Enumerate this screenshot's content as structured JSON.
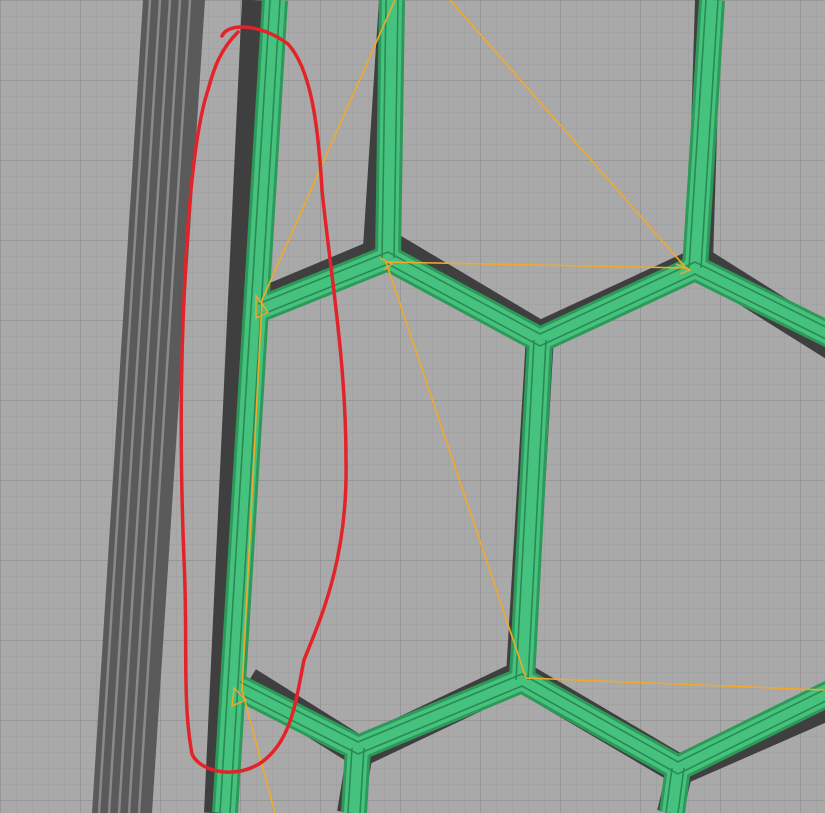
{
  "viewport": {
    "background": "#a9a9a9",
    "grid_color": "#9d9d9d",
    "grid_major_color": "#8f8f8f",
    "wall_color": "#3fbf77",
    "wall_highlight": "#6ad79a",
    "wall_shadow": "#3f3f3f",
    "skirt_color": "#6b6b6b",
    "travel_color": "#f0a92a",
    "annotation_color": "#e3232a"
  }
}
